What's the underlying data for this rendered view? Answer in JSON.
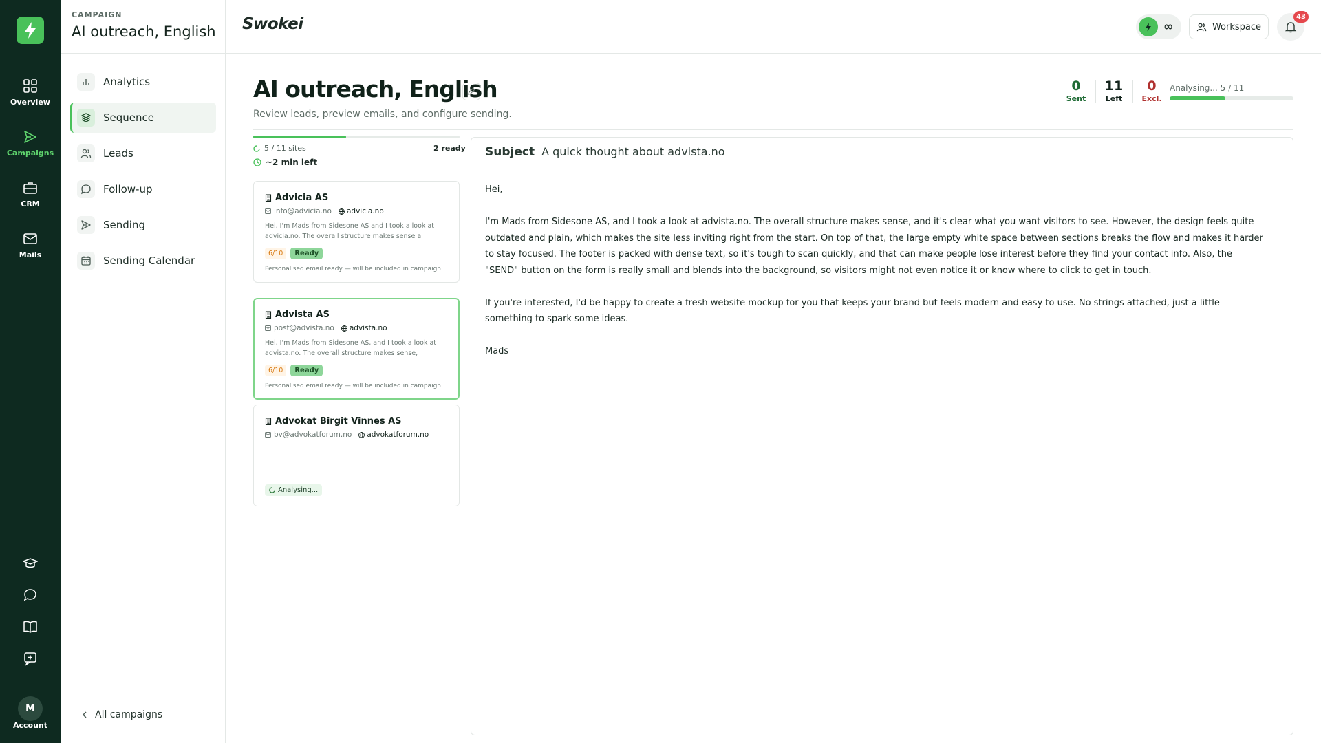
{
  "rail": {
    "items": [
      {
        "label": "Overview"
      },
      {
        "label": "Campaigns"
      },
      {
        "label": "CRM"
      },
      {
        "label": "Mails"
      }
    ],
    "account": {
      "initial": "M",
      "label": "Account"
    }
  },
  "sidebar": {
    "kicker": "CAMPAIGN",
    "title": "AI outreach, English",
    "items": [
      {
        "label": "Analytics",
        "icon": "bar-chart-icon"
      },
      {
        "label": "Sequence",
        "icon": "layers-icon",
        "active": true
      },
      {
        "label": "Leads",
        "icon": "users-icon"
      },
      {
        "label": "Follow-up",
        "icon": "chat-bubble-icon"
      },
      {
        "label": "Sending",
        "icon": "send-icon"
      },
      {
        "label": "Sending Calendar",
        "icon": "calendar-icon"
      }
    ],
    "footer": "All campaigns"
  },
  "topbar": {
    "brand": "Swokei",
    "credits": "∞",
    "workspace": "Workspace",
    "notifications": "43"
  },
  "page": {
    "title": "AI outreach, English",
    "subtitle": "Review leads, preview emails, and configure sending."
  },
  "stats": {
    "sent": {
      "value": "0",
      "label": "Sent"
    },
    "left": {
      "value": "11",
      "label": "Left"
    },
    "excluded": {
      "value": "0",
      "label": "Excl."
    },
    "analysing_label": "Analysing... 5 / 11",
    "analysing_progress": 0.45,
    "colors": {
      "sent": "#1f6b35",
      "excluded": "#b0312f",
      "accent": "#49c15a"
    }
  },
  "leads": {
    "sites_status": "5 / 11 sites",
    "ready_count": "2 ready",
    "time_left": "~2 min left",
    "progress": 0.45,
    "cards": [
      {
        "name": "Advicia AS",
        "email": "info@advicia.no",
        "domain": "advicia.no",
        "snippet": "Hei, I'm Mads from Sidesone AS and I took a look at advicia.no. The overall structure makes sense a",
        "score": "6/10",
        "status": "Ready",
        "note": "Personalised email ready — will be included in campaign"
      },
      {
        "name": "Advista AS",
        "email": "post@advista.no",
        "domain": "advista.no",
        "snippet": "Hei, I'm Mads from Sidesone AS, and I took a look at advista.no. The overall structure makes sense,",
        "score": "6/10",
        "status": "Ready",
        "note": "Personalised email ready — will be included in campaign"
      },
      {
        "name": "Advokat Birgit Vinnes AS",
        "email": "bv@advokatforum.no",
        "domain": "advokatforum.no",
        "status": "Analysing..."
      }
    ]
  },
  "email": {
    "subject_label": "Subject",
    "subject": "A quick thought about advista.no",
    "greeting": "Hei,",
    "paragraph1": "I'm Mads from Sidesone AS, and I took a look at advista.no. The overall structure makes sense, and it's clear what you want visitors to see. However, the design feels quite outdated and plain, which makes the site less inviting right from the start. On top of that, the large empty white space between sections breaks the flow and makes it harder to stay focused. The footer is packed with dense text, so it's tough to scan quickly, and that can make people lose interest before they find your contact info. Also, the \"SEND\" button on the form is really small and blends into the background, so visitors might not even notice it or know where to click to get in touch.",
    "paragraph2": "If you're interested, I'd be happy to create a fresh website mockup for you that keeps your brand but feels modern and easy to use. No strings attached, just a little something to spark some ideas.",
    "signature": "Mads"
  }
}
